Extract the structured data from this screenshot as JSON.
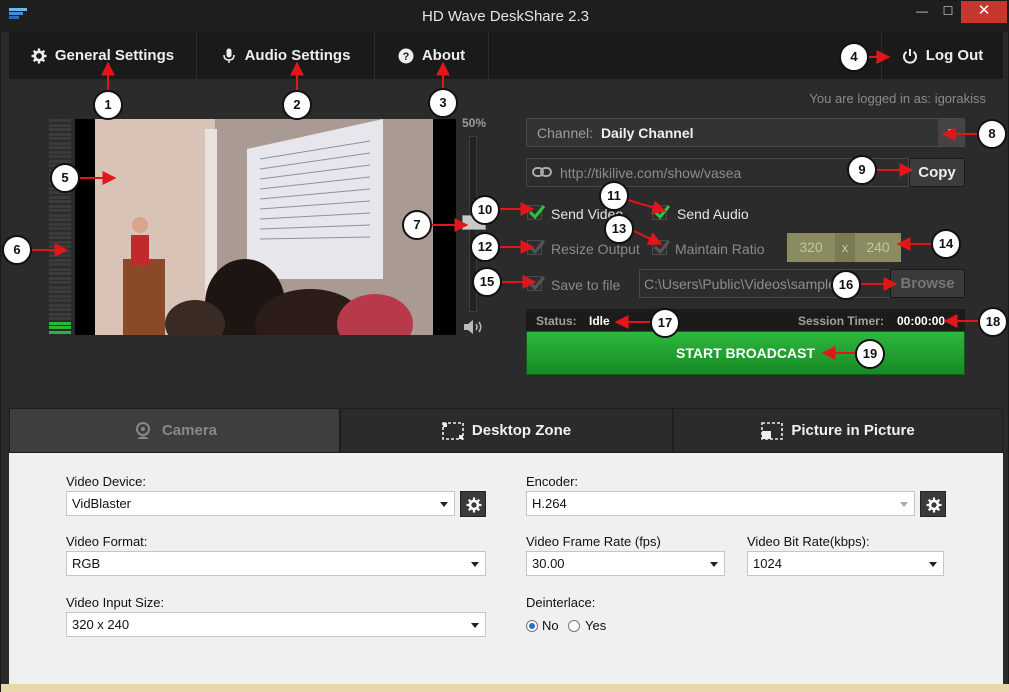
{
  "window": {
    "title": "HD Wave DeskShare 2.3",
    "minimize_label": "—",
    "maximize_label": "☐",
    "close_label": "✕"
  },
  "nav": {
    "general_settings": "General Settings",
    "audio_settings": "Audio Settings",
    "about": "About",
    "log_out": "Log Out"
  },
  "logged_in": "You are logged in as:  igorakiss",
  "volume": {
    "percent_label": "50%",
    "level": 0.5
  },
  "channel": {
    "prefix": "Channel:",
    "name": "Daily Channel"
  },
  "url": {
    "value": "http://tikilive.com/show/vasea",
    "copy_label": "Copy"
  },
  "options": {
    "send_video": {
      "label": "Send Video",
      "checked": true
    },
    "send_audio": {
      "label": "Send Audio",
      "checked": true
    },
    "resize_output": {
      "label": "Resize Output",
      "checked": true
    },
    "maintain_ratio": {
      "label": "Maintain Ratio",
      "checked": true
    },
    "width": "320",
    "x": "x",
    "height": "240",
    "save_to_file": {
      "label": "Save to file",
      "checked": true
    },
    "file_path": "C:\\Users\\Public\\Videos\\sample.f4",
    "browse_label": "Browse"
  },
  "status": {
    "label": "Status:",
    "value": "Idle",
    "timer_label": "Session Timer:",
    "timer_value": "00:00:00"
  },
  "start_label": "START BROADCAST",
  "tabs": {
    "camera": "Camera",
    "desktop_zone": "Desktop Zone",
    "pip": "Picture in Picture"
  },
  "settings": {
    "video_device_label": "Video Device:",
    "video_device_value": "VidBlaster",
    "video_format_label": "Video Format:",
    "video_format_value": "RGB",
    "video_input_size_label": "Video Input Size:",
    "video_input_size_value": "320 x 240",
    "encoder_label": "Encoder:",
    "encoder_value": "H.264",
    "frame_rate_label": "Video Frame Rate (fps)",
    "frame_rate_value": "30.00",
    "bit_rate_label": "Video Bit Rate(kbps):",
    "bit_rate_value": "1024",
    "deinterlace_label": "Deinterlace:",
    "deinterlace_no": "No",
    "deinterlace_yes": "Yes",
    "deinterlace_selected": "No"
  },
  "vu_meter": {
    "lit_bars": 3,
    "total_bars": 48
  },
  "callouts": [
    "1",
    "2",
    "3",
    "4",
    "5",
    "6",
    "7",
    "8",
    "9",
    "10",
    "11",
    "12",
    "13",
    "14",
    "15",
    "16",
    "17",
    "18",
    "19"
  ],
  "colors": {
    "accent_green": "#27b63a",
    "annotation_red": "#e0161b",
    "close_red": "#c7372f"
  }
}
